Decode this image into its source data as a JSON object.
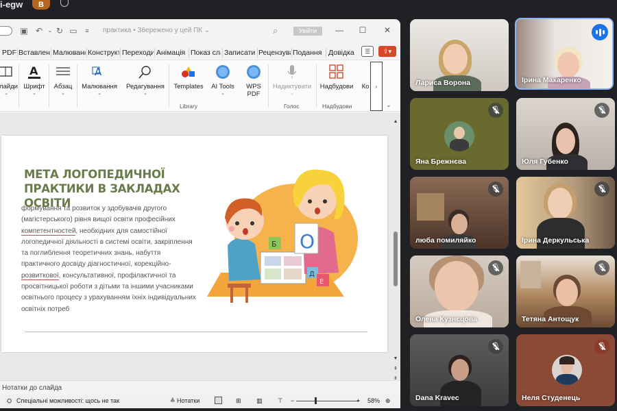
{
  "meet": {
    "code": "i-egw",
    "avatar_letter": "B"
  },
  "ppt": {
    "title": "практика • Збережено у цей ПК ⌄",
    "signin": "Увійти",
    "tabs": [
      "PDF",
      "Вставлення",
      "Малювання",
      "Конструктор",
      "Переходи",
      "Анімація",
      "Показ слайдів",
      "Записати",
      "Рецензування",
      "Подання",
      "Довідка"
    ],
    "ribbon": {
      "slides": "Слайди",
      "font": "Шрифт",
      "paragraph": "Абзац",
      "drawing": "Малювання",
      "editing": "Редагування",
      "templates": "Templates",
      "ai_tools": "AI Tools",
      "wps_pdf_1": "WPS",
      "wps_pdf_2": "PDF",
      "dictate": "Надиктувати",
      "addins": "Надбудови",
      "more": "Ко",
      "group_library": "Library",
      "group_voice": "Голос",
      "group_addins": "Надбудови"
    },
    "slide": {
      "title": "МЕТА ЛОГОПЕДИЧНОЇ ПРАКТИКИ В ЗАКЛАДАХ ОСВІТИ",
      "body_1": "формування та розвиток у здобувачів другого (магістерського) рівня вищої освіти професійних ",
      "body_ul1": "компетентностей",
      "body_2": ", необхідних для самостійної логопедичної діяльності в системі освіти, закріплення та поглиблення теоретичних знань, набуття практичного досвіду діагностичної, корекційно-",
      "body_ul2": "розвиткової",
      "body_3": ", консультативної, профілактичної та просвітницької роботи з дітьми та іншими учасниками освітнього процесу з урахуванням їхніх індивідуальних освітніх потреб",
      "card_letter": "О",
      "cube_1": "Б",
      "cube_2": "Д",
      "cube_3": "Е"
    },
    "notes": "Нотатки до слайда",
    "status": {
      "accessibility": "Спеціальні можливості: щось не так",
      "notes_btn": "Нотатки",
      "zoom": "58%"
    }
  },
  "participants": [
    {
      "name": "Лариса Ворона",
      "muted": false
    },
    {
      "name": "Ірина Макаренко",
      "muted": false,
      "speaking": true
    },
    {
      "name": "Яна Брежнєва",
      "muted": true
    },
    {
      "name": "Юля Губенко",
      "muted": true
    },
    {
      "name": "люба помиляйко",
      "muted": true
    },
    {
      "name": "Ірина Деркульська",
      "muted": true
    },
    {
      "name": "Олена Кузнєцова",
      "muted": true
    },
    {
      "name": "Тетяна Антощук",
      "muted": true
    },
    {
      "name": "Dana Kravec",
      "muted": true
    },
    {
      "name": "Неля Студенець",
      "muted": true
    }
  ],
  "colors": {
    "slide_title": "#6b7a4b",
    "share": "#d9472b",
    "speaking": "#1a73e8",
    "active_border": "#8ab4f8"
  }
}
